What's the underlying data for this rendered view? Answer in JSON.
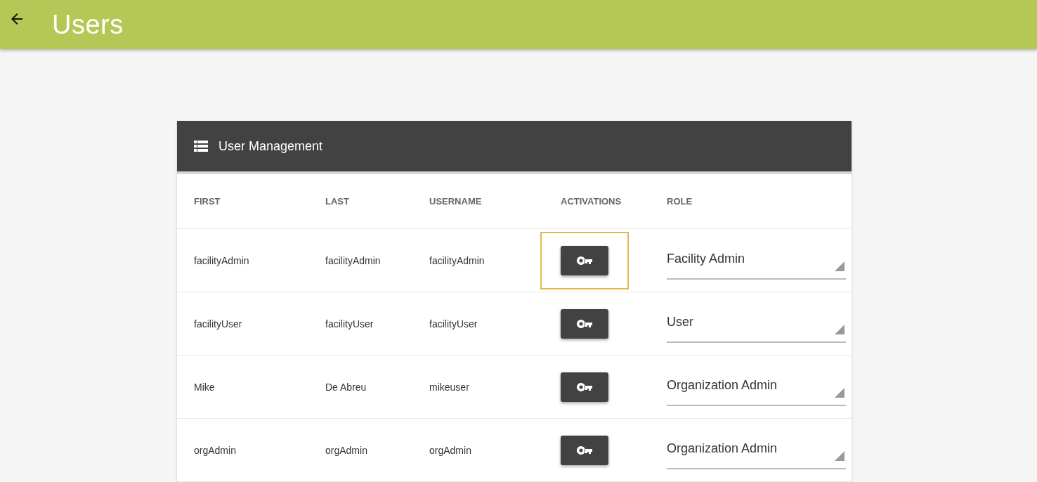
{
  "app_bar": {
    "title": "Users"
  },
  "card": {
    "title": "User Management",
    "columns": [
      "FIRST",
      "LAST",
      "USERNAME",
      "ACTIVATIONS",
      "ROLE"
    ],
    "rows": [
      {
        "first": "facilityAdmin",
        "last": "facilityAdmin",
        "username": "facilityAdmin",
        "activation_focused": true,
        "role": "Facility Admin"
      },
      {
        "first": "facilityUser",
        "last": "facilityUser",
        "username": "facilityUser",
        "activation_focused": false,
        "role": "User"
      },
      {
        "first": "Mike",
        "last": "De Abreu",
        "username": "mikeuser",
        "activation_focused": false,
        "role": "Organization Admin"
      },
      {
        "first": "orgAdmin",
        "last": "orgAdmin",
        "username": "orgAdmin",
        "activation_focused": false,
        "role": "Organization Admin"
      }
    ]
  }
}
